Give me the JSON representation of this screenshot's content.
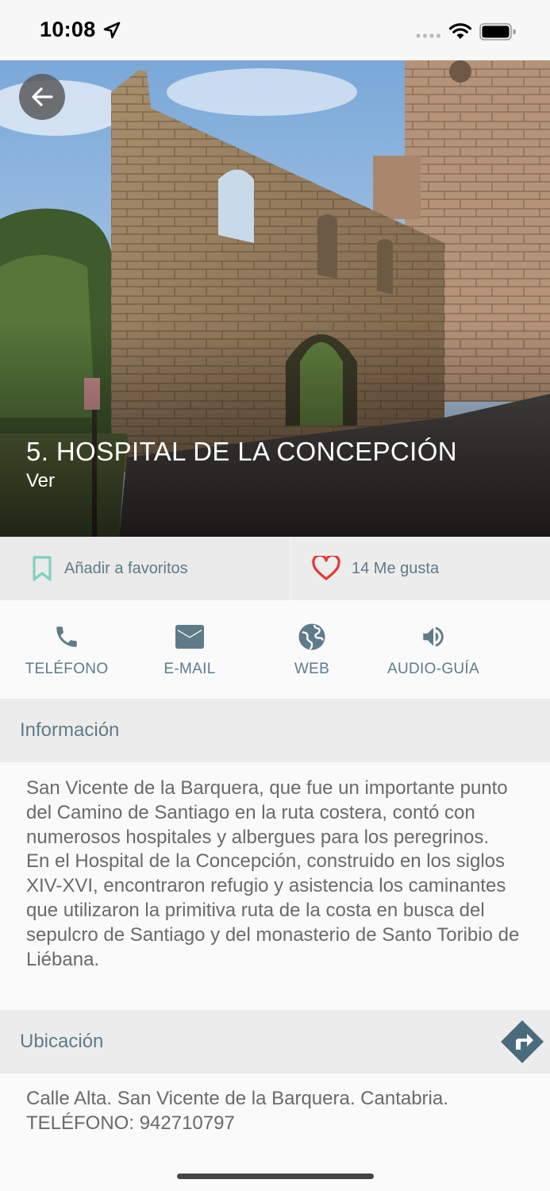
{
  "status_bar": {
    "time": "10:08"
  },
  "hero": {
    "title": "5. HOSPITAL DE LA CONCEPCIÓN",
    "subtitle": "Ver"
  },
  "actions": {
    "favorites_label": "Añadir a favoritos",
    "likes_label": "14 Me gusta"
  },
  "contacts": [
    {
      "label": "TELÉFONO",
      "icon": "phone-icon"
    },
    {
      "label": "E-MAIL",
      "icon": "mail-icon"
    },
    {
      "label": "WEB",
      "icon": "globe-icon"
    },
    {
      "label": "AUDIO-GUÍA",
      "icon": "speaker-icon"
    }
  ],
  "info": {
    "title": "Información",
    "text": "San Vicente de la Barquera, que fue un importante punto del Camino de Santiago en la ruta costera, contó con numerosos hospitales y albergues para los peregrinos.\nEn el Hospital de la Concepción, construido en los siglos XIV-XVI, encontraron refugio y asistencia los caminantes que utilizaron la primitiva ruta de la costa en busca del sepulcro de Santiago y del monasterio de Santo Toribio de Liébana."
  },
  "location": {
    "title": "Ubicación",
    "text": "Calle Alta. San Vicente de la Barquera. Cantabria.\nTELÉFONO: 942710797"
  },
  "colors": {
    "accent": "#5f7b8a",
    "bookmark": "#7fd0c0",
    "heart": "#e53935",
    "directions": "#4a6b7c"
  }
}
